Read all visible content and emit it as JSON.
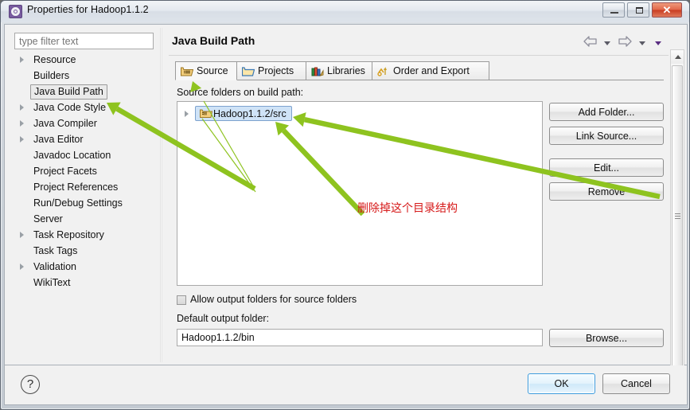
{
  "window": {
    "title": "Properties for Hadoop1.1.2",
    "icon": "properties-gear-icon",
    "minimize_label": "",
    "maximize_label": "",
    "close_label": "✕"
  },
  "filter": {
    "placeholder": "type filter text",
    "value": ""
  },
  "tree": {
    "items": [
      {
        "label": "Resource",
        "expandable": true,
        "selected": false
      },
      {
        "label": "Builders",
        "expandable": false,
        "selected": false
      },
      {
        "label": "Java Build Path",
        "expandable": false,
        "selected": true
      },
      {
        "label": "Java Code Style",
        "expandable": true,
        "selected": false
      },
      {
        "label": "Java Compiler",
        "expandable": true,
        "selected": false
      },
      {
        "label": "Java Editor",
        "expandable": true,
        "selected": false
      },
      {
        "label": "Javadoc Location",
        "expandable": false,
        "selected": false
      },
      {
        "label": "Project Facets",
        "expandable": false,
        "selected": false
      },
      {
        "label": "Project References",
        "expandable": false,
        "selected": false
      },
      {
        "label": "Run/Debug Settings",
        "expandable": false,
        "selected": false
      },
      {
        "label": "Server",
        "expandable": false,
        "selected": false
      },
      {
        "label": "Task Repository",
        "expandable": true,
        "selected": false
      },
      {
        "label": "Task Tags",
        "expandable": false,
        "selected": false
      },
      {
        "label": "Validation",
        "expandable": true,
        "selected": false
      },
      {
        "label": "WikiText",
        "expandable": false,
        "selected": false
      }
    ]
  },
  "page": {
    "heading": "Java Build Path",
    "nav": {
      "back_icon": "back-arrow-icon",
      "back_menu_icon": "chevron-down-icon",
      "forward_icon": "forward-arrow-icon",
      "forward_menu_icon": "chevron-down-icon",
      "view_menu_icon": "chevron-down-purple-icon"
    },
    "tabs": [
      {
        "label": "Source",
        "icon": "source-folder-icon",
        "active": true
      },
      {
        "label": "Projects",
        "icon": "projects-folder-icon",
        "active": false
      },
      {
        "label": "Libraries",
        "icon": "libraries-books-icon",
        "active": false
      },
      {
        "label": "Order and Export",
        "icon": "order-export-icon",
        "active": false
      }
    ],
    "source_section": {
      "label": "Source folders on build path:",
      "entries": [
        {
          "label": "Hadoop1.1.2/src",
          "icon": "source-folder-icon",
          "selected": true,
          "expandable": true
        }
      ],
      "buttons": [
        {
          "label": "Add Folder...",
          "name": "add-folder-button"
        },
        {
          "label": "Link Source...",
          "name": "link-source-button"
        },
        {
          "label": "Edit...",
          "name": "edit-button"
        },
        {
          "label": "Remove",
          "name": "remove-button"
        }
      ]
    },
    "allow_output": {
      "label": "Allow output folders for source folders",
      "checked": false
    },
    "default_output": {
      "label": "Default output folder:",
      "value": "Hadoop1.1.2/bin",
      "browse_label": "Browse..."
    }
  },
  "bottom": {
    "help_glyph": "?",
    "ok_label": "OK",
    "cancel_label": "Cancel"
  },
  "annotation": {
    "note_text": "删除掉这个目录结构",
    "note_color": "#d61a1a",
    "arrow_color": "#8ec31f"
  },
  "scrollbar": {
    "up_icon": "scroll-up-arrow-icon",
    "down_icon": "scroll-down-arrow-icon"
  }
}
